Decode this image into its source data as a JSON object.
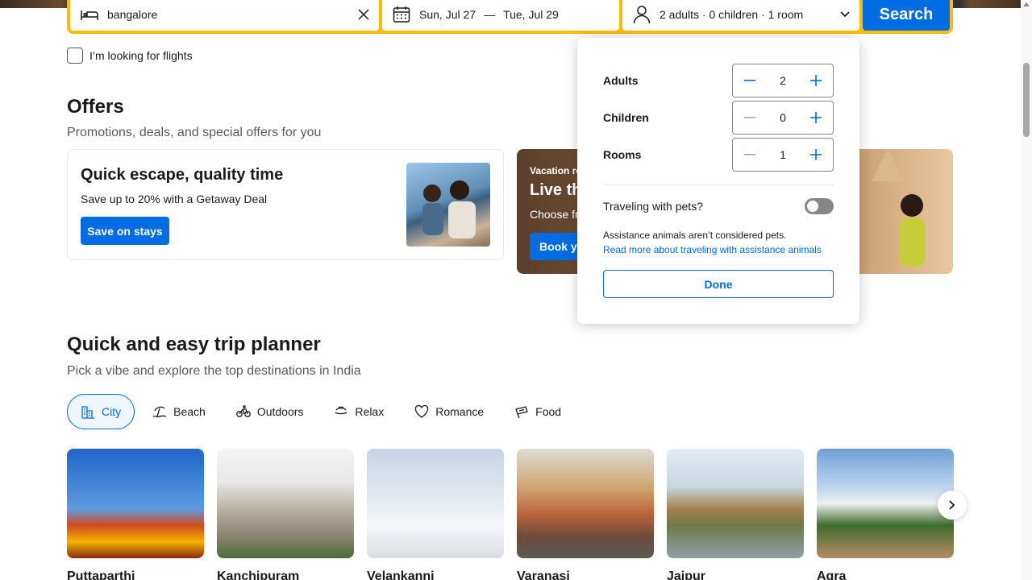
{
  "search": {
    "destination": "bangalore",
    "checkin": "Sun, Jul 27",
    "date_separator": "—",
    "checkout": "Tue, Jul 29",
    "guests_summary": "2 adults · 0 children · 1 room",
    "search_label": "Search",
    "flights_label": "I’m looking for flights"
  },
  "offers": {
    "title": "Offers",
    "subtitle": "Promotions, deals, and special offers for you",
    "card1": {
      "heading": "Quick escape, quality time",
      "text": "Save up to 20% with a Getaway Deal",
      "button": "Save on stays"
    },
    "card2": {
      "eyebrow": "Vacation re",
      "heading": "Live th",
      "text": "Choose fr",
      "button": "Book yo"
    }
  },
  "guests_popover": {
    "rows": [
      {
        "label": "Adults",
        "value": "2"
      },
      {
        "label": "Children",
        "value": "0"
      },
      {
        "label": "Rooms",
        "value": "1"
      }
    ],
    "pets_label": "Traveling with pets?",
    "pets_enabled": false,
    "note": "Assistance animals aren’t considered pets.",
    "note_link": "Read more about traveling with assistance animals",
    "done_label": "Done"
  },
  "trip_planner": {
    "title": "Quick and easy trip planner",
    "subtitle": "Pick a vibe and explore the top destinations in India",
    "vibes": [
      {
        "label": "City",
        "icon": "city-icon",
        "active": true
      },
      {
        "label": "Beach",
        "icon": "beach-icon",
        "active": false
      },
      {
        "label": "Outdoors",
        "icon": "bike-icon",
        "active": false
      },
      {
        "label": "Relax",
        "icon": "relax-icon",
        "active": false
      },
      {
        "label": "Romance",
        "icon": "heart-icon",
        "active": false
      },
      {
        "label": "Food",
        "icon": "food-icon",
        "active": false
      }
    ],
    "destinations": [
      {
        "name": "Puttaparthi"
      },
      {
        "name": "Kanchipuram"
      },
      {
        "name": "Velankanni"
      },
      {
        "name": "Varanasi"
      },
      {
        "name": "Jaipur"
      },
      {
        "name": "Agra"
      }
    ]
  },
  "colors": {
    "brand_blue": "#006ce4",
    "search_border": "#febb02"
  }
}
